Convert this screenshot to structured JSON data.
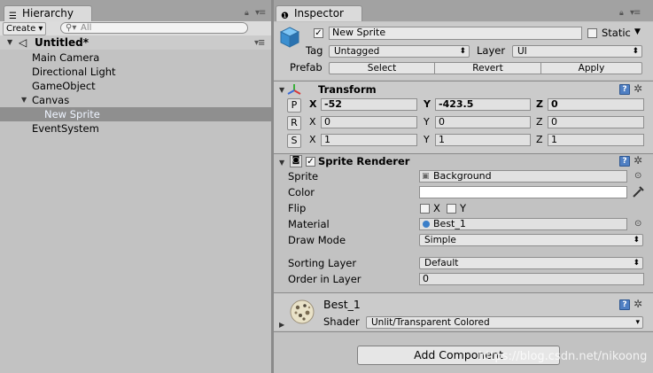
{
  "colors": {
    "panel_bg": "#c2c2c2",
    "selection_bg": "#8f8f8f",
    "selection_text": "#eef4ff",
    "tab_bg": "#dadada"
  },
  "hierarchy": {
    "tab_title": "Hierarchy",
    "create_label": "Create ▾",
    "search_placeholder": "All",
    "scene_name": "Untitled*",
    "items": [
      {
        "label": "Main Camera"
      },
      {
        "label": "Directional Light"
      },
      {
        "label": "GameObject"
      },
      {
        "label": "Canvas"
      },
      {
        "label": "New Sprite"
      },
      {
        "label": "EventSystem"
      }
    ]
  },
  "inspector": {
    "tab_title": "Inspector",
    "object_name": "New Sprite",
    "static_label": "Static",
    "tag_label": "Tag",
    "tag_value": "Untagged",
    "layer_label": "Layer",
    "layer_value": "UI",
    "prefab_label": "Prefab",
    "prefab_buttons": [
      "Select",
      "Revert",
      "Apply"
    ]
  },
  "transform": {
    "title": "Transform",
    "rows": [
      {
        "btn": "P",
        "x": "-52",
        "y": "-423.5",
        "z": "0"
      },
      {
        "btn": "R",
        "x": "0",
        "y": "0",
        "z": "0"
      },
      {
        "btn": "S",
        "x": "1",
        "y": "1",
        "z": "1"
      }
    ],
    "axis_labels": [
      "X",
      "Y",
      "Z"
    ]
  },
  "sprite_renderer": {
    "title": "Sprite Renderer",
    "sprite_label": "Sprite",
    "sprite_value": "Background",
    "color_label": "Color",
    "flip_label": "Flip",
    "flip_x": "X",
    "flip_y": "Y",
    "material_label": "Material",
    "material_value": "Best_1",
    "draw_mode_label": "Draw Mode",
    "draw_mode_value": "Simple",
    "sorting_layer_label": "Sorting Layer",
    "sorting_layer_value": "Default",
    "order_label": "Order in Layer",
    "order_value": "0"
  },
  "material": {
    "name": "Best_1",
    "shader_label": "Shader",
    "shader_value": "Unlit/Transparent Colored"
  },
  "add_component_label": "Add Component",
  "watermark": "https://blog.csdn.net/nikoong"
}
